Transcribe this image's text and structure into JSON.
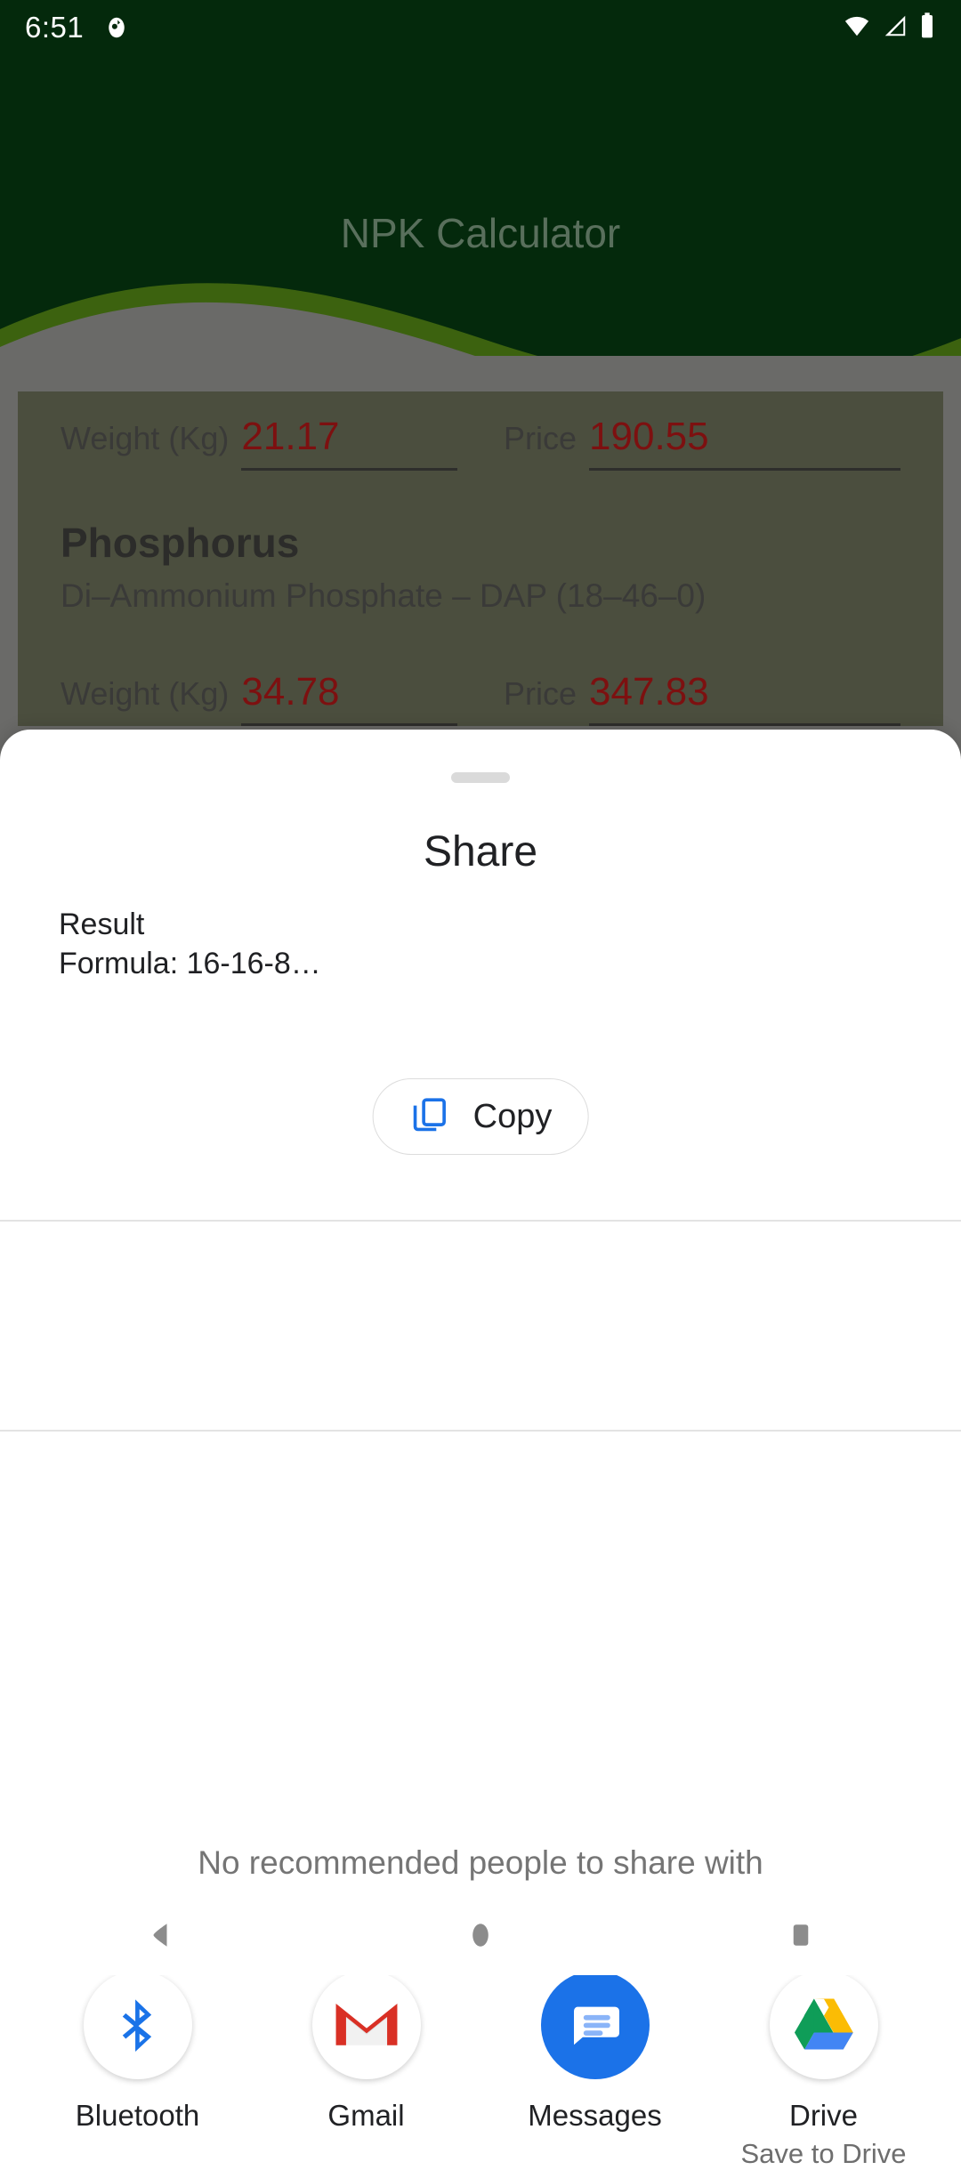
{
  "status_bar": {
    "time": "6:51",
    "notification_icon": "app-notification-icon",
    "wifi_icon": "wifi-icon",
    "signal_icon": "cellular-signal-icon",
    "battery_icon": "battery-full-icon"
  },
  "app": {
    "title": "NPK Calculator",
    "header_color": "#04290c",
    "wave_accent_color": "#2f5411",
    "value_color": "#7d1010",
    "rows": [
      {
        "weight_label": "Weight (Kg)",
        "weight_value": "21.17",
        "price_label": "Price",
        "price_value": "190.55"
      }
    ],
    "nutrient": {
      "name": "Phosphorus",
      "subtitle": "Di–Ammonium Phosphate – DAP (18–46–0)",
      "weight_label": "Weight (Kg)",
      "weight_value": "34.78",
      "price_label": "Price",
      "price_value": "347.83"
    }
  },
  "share_sheet": {
    "title": "Share",
    "drag_handle": "sheet-drag-handle",
    "preview": {
      "title": "Result",
      "subtitle": "Formula: 16-16-8…"
    },
    "copy": {
      "label": "Copy",
      "icon": "copy-icon",
      "icon_color": "#1b72e8"
    },
    "empty_people_text": "No recommended people to share with",
    "apps": [
      {
        "label": "Bluetooth",
        "sublabel": "",
        "icon": "bluetooth-icon",
        "icon_style": "white-circle"
      },
      {
        "label": "Gmail",
        "sublabel": "",
        "icon": "gmail-icon",
        "icon_style": "white-circle"
      },
      {
        "label": "Messages",
        "sublabel": "",
        "icon": "messages-icon",
        "icon_style": "blue-circle"
      },
      {
        "label": "Drive",
        "sublabel": "Save to Drive",
        "icon": "google-drive-icon",
        "icon_style": "white-circle"
      }
    ]
  },
  "nav_bar": {
    "back": "back-nav-icon",
    "home": "home-nav-icon",
    "recents": "recents-nav-icon"
  }
}
